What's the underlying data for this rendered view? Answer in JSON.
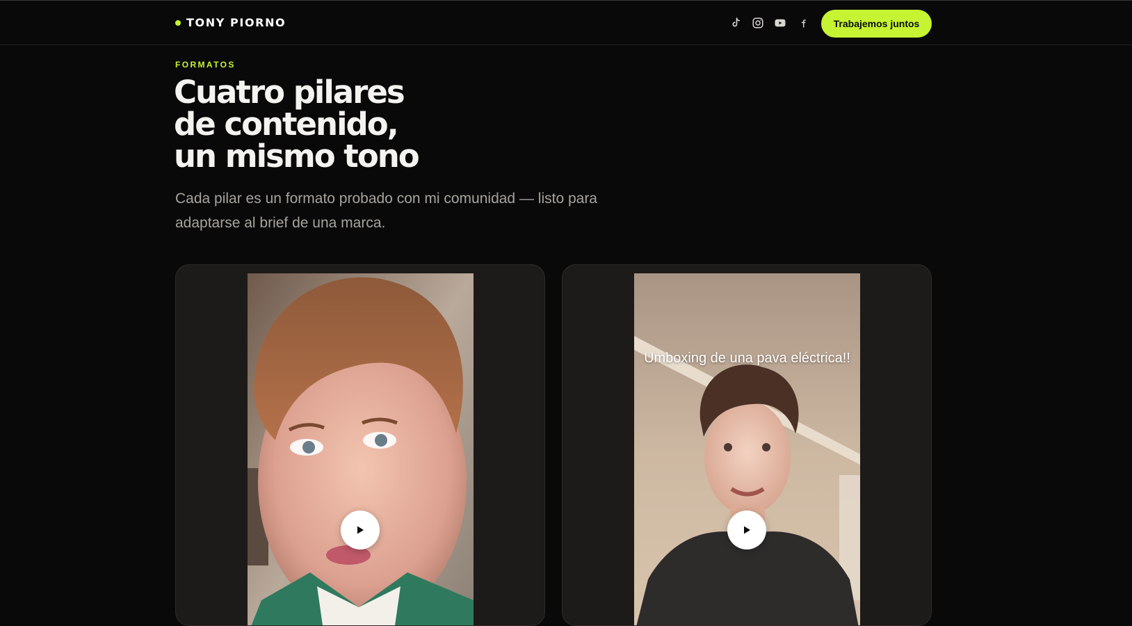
{
  "header": {
    "brand_name": "TONY PIORNO",
    "socials": [
      {
        "icon": "tiktok-icon"
      },
      {
        "icon": "instagram-icon"
      },
      {
        "icon": "youtube-icon"
      },
      {
        "icon": "facebook-icon"
      }
    ],
    "cta_label": "Trabajemos juntos"
  },
  "section": {
    "eyebrow": "FORMATOS",
    "title_lines": [
      "Cuatro pilares",
      "de contenido,",
      "un mismo tono"
    ],
    "subtitle": "Cada pilar es un formato probado con mi comunidad — listo para adaptarse al brief de una marca."
  },
  "cards": [
    {
      "overlay_text": "",
      "play_icon": "play-icon"
    },
    {
      "overlay_text": "Umboxing de una pava eléctrica!!",
      "play_icon": "play-icon"
    }
  ],
  "colors": {
    "background": "#0a0909",
    "accent": "#c6f432",
    "card": "#1d1b19",
    "muted_text": "#a7a39d"
  }
}
